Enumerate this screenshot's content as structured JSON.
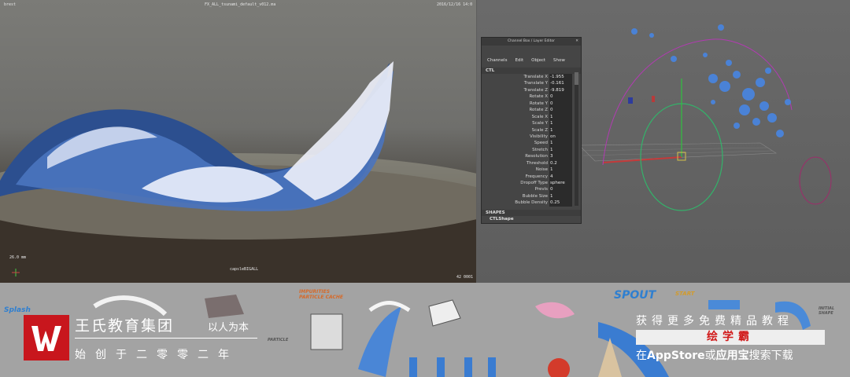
{
  "left_viewport": {
    "panel_label": "brest",
    "file_name": "FX_ALL_tsunami_default_v012.ma",
    "date_stamp": "2016/12/16 14:0",
    "frame_rate": "26.0 mm",
    "camera_name": "capsleBIGALL",
    "frame_counter": "42 0001"
  },
  "channel_box": {
    "title": "Channel Box / Layer Editor",
    "menu": [
      "Channels",
      "Edit",
      "Object",
      "Show"
    ],
    "section_ctl": "CTL",
    "attributes": [
      {
        "name": "Translate X",
        "value": "-1.955"
      },
      {
        "name": "Translate Y",
        "value": "-0.161"
      },
      {
        "name": "Translate Z",
        "value": "-9.819"
      },
      {
        "name": "Rotate X",
        "value": "0"
      },
      {
        "name": "Rotate Y",
        "value": "0"
      },
      {
        "name": "Rotate Z",
        "value": "0"
      },
      {
        "name": "Scale X",
        "value": "1"
      },
      {
        "name": "Scale Y",
        "value": "1"
      },
      {
        "name": "Scale Z",
        "value": "1"
      },
      {
        "name": "Visibility",
        "value": "on"
      },
      {
        "name": "Speed",
        "value": "1"
      },
      {
        "name": "Stretch",
        "value": "1"
      },
      {
        "name": "Resolution",
        "value": "3"
      },
      {
        "name": "Threshold",
        "value": "0.2"
      },
      {
        "name": "Noise",
        "value": "1"
      },
      {
        "name": "Frequency",
        "value": "4"
      },
      {
        "name": "Dropoff Type",
        "value": "sphere"
      },
      {
        "name": "Previs",
        "value": "0"
      },
      {
        "name": "Bubble Size",
        "value": "1"
      },
      {
        "name": "Bubble Density",
        "value": "0.25"
      }
    ],
    "section_shapes": "SHAPES",
    "shape_name": "CTLShape"
  },
  "sketch_labels": {
    "splash": "Splash",
    "impurities": "IMPURITIES PARTICLE CACHE",
    "particle": "PARTICLE",
    "spout": "SPOUT",
    "start": "START",
    "initial_shape": "INITIAL SHAPE"
  },
  "brand": {
    "name": "王氏教育集团",
    "slogan": "以人为本",
    "year_line": "始创于二零零二年",
    "color": "#c8161d"
  },
  "promo": {
    "line1": "获得更多免费精品教程",
    "app_name": "绘学霸",
    "line3_prefix": "在",
    "store1": "AppStore",
    "connector": "或",
    "store2": "应用宝",
    "line3_suffix": "搜索下载"
  }
}
